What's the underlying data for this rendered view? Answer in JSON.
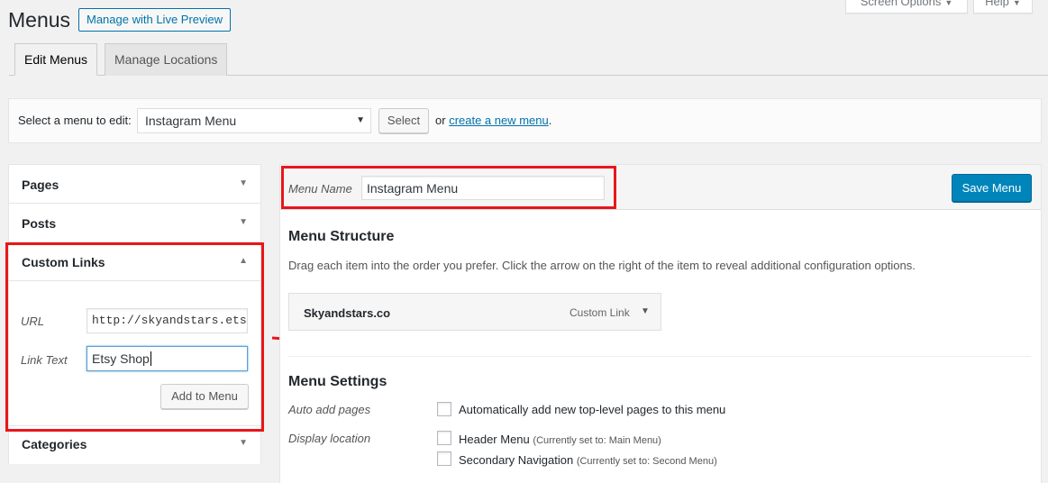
{
  "header": {
    "title": "Menus",
    "live_preview": "Manage with Live Preview",
    "screen_options": "Screen Options",
    "help": "Help"
  },
  "tabs": [
    {
      "label": "Edit Menus",
      "active": true
    },
    {
      "label": "Manage Locations",
      "active": false
    }
  ],
  "manage": {
    "label": "Select a menu to edit:",
    "selected_menu": "Instagram Menu",
    "select_button": "Select",
    "or_text": "or",
    "create_link": "create a new menu",
    "period": "."
  },
  "accordion": {
    "pages": "Pages",
    "posts": "Posts",
    "custom_links": "Custom Links",
    "categories": "Categories",
    "url_label": "URL",
    "url_value": "http://skyandstars.ets",
    "link_text_label": "Link Text",
    "link_text_value": "Etsy Shop",
    "add_button": "Add to Menu"
  },
  "menu_panel": {
    "name_label": "Menu Name",
    "name_value": "Instagram Menu",
    "save_button": "Save Menu",
    "structure_title": "Menu Structure",
    "structure_desc": "Drag each item into the order you prefer. Click the arrow on the right of the item to reveal additional configuration options.",
    "items": [
      {
        "title": "Skyandstars.co",
        "type": "Custom Link"
      }
    ],
    "settings_title": "Menu Settings",
    "auto_add_label": "Auto add pages",
    "auto_add_option": "Automatically add new top-level pages to this menu",
    "display_location_label": "Display location",
    "locations": [
      {
        "label": "Header Menu",
        "note": "(Currently set to: Main Menu)"
      },
      {
        "label": "Secondary Navigation",
        "note": "(Currently set to: Second Menu)"
      }
    ]
  },
  "colors": {
    "accent": "#0073aa",
    "primary_button": "#0085ba",
    "highlight": "#e8161b",
    "background": "#f1f1f1"
  }
}
